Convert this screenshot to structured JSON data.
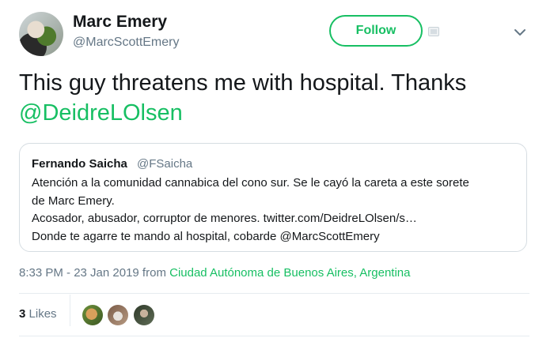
{
  "author": {
    "name": "Marc Emery",
    "handle": "@MarcScottEmery"
  },
  "follow_button": {
    "label": "Follow"
  },
  "tweet": {
    "text": "This guy threatens me with hospital. Thanks",
    "mention": "@DeidreLOlsen"
  },
  "quoted_tweet": {
    "name": "Fernando Saicha",
    "handle": "@FSaicha",
    "lines": [
      "Atención a la comunidad cannabica del cono sur. Se le cayó la careta a este sorete",
      "de Marc Emery.",
      "Acosador, abusador, corruptor de menores. twitter.com/DeidreLOlsen/s…",
      "Donde te agarre te mando al hospital, cobarde @MarcScottEmery"
    ]
  },
  "meta": {
    "time": "8:33 PM - 23 Jan 2019 from",
    "place": "Ciudad Autónoma de Buenos Aires, Argentina"
  },
  "likes": {
    "count": "3",
    "label": "Likes"
  },
  "colors": {
    "accent": "#17bf63",
    "muted": "#657786",
    "text": "#14171a",
    "border": "#d6dde2"
  },
  "icons": [
    "badge-icon",
    "chevron-down-icon"
  ]
}
